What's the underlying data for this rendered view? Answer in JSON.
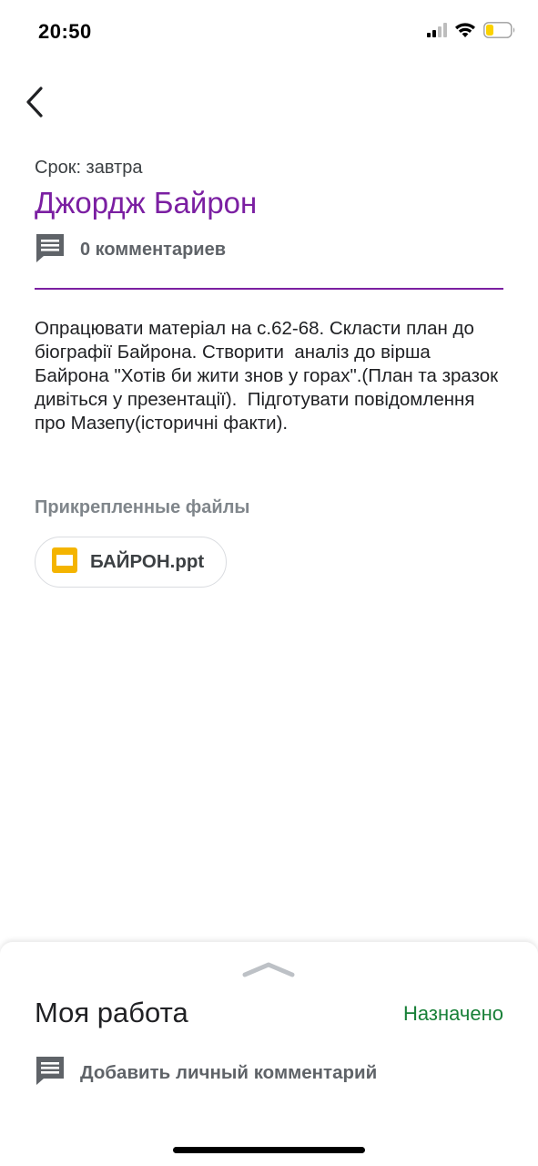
{
  "status_bar": {
    "time": "20:50",
    "icons": [
      "cellular-signal-icon",
      "wifi-icon",
      "battery-icon"
    ]
  },
  "header": {
    "back_icon": "chevron-left-icon"
  },
  "assignment": {
    "due": "Срок: завтра",
    "title": "Джордж Байрон",
    "comments_label": "0 комментариев",
    "description": "Опрацювати матеріал на с.62-68. Скласти план до біографії Байрона. Створити  аналіз до вірша Байрона \"Хотів би жити знов у горах\".(План та зразок дивіться у презентації).  Підготувати повідомлення про Мазепу(історичні факти)."
  },
  "attachments": {
    "heading": "Прикрепленные файлы",
    "files": [
      {
        "name": "БАЙРОН.ppt",
        "icon": "slides-file-icon"
      }
    ]
  },
  "my_work": {
    "title": "Моя работа",
    "status": "Назначено",
    "private_comment_label": "Добавить личный комментарий"
  },
  "colors": {
    "accent": "#7b1fa2",
    "status_green": "#188038",
    "slides_yellow": "#f4b400"
  }
}
